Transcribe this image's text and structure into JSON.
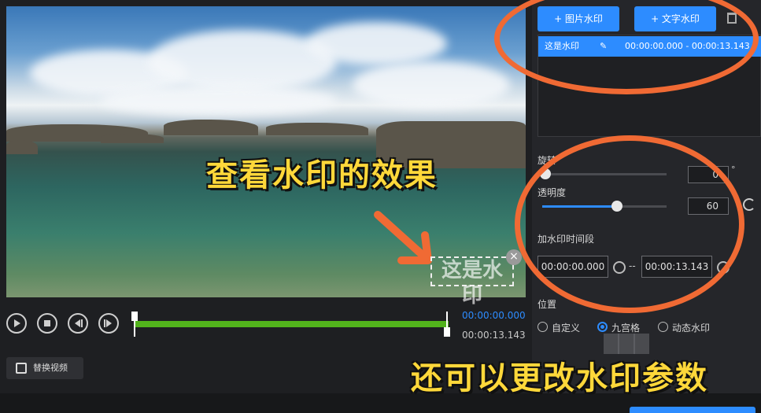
{
  "preview": {
    "overlay_text": "查看水印的效果",
    "watermark_text": "这是水印",
    "close_glyph": "×"
  },
  "timeline": {
    "current_time": "00:00:00.000",
    "end_time": "00:00:13.143",
    "controls": [
      "play",
      "stop",
      "prev-frame",
      "next-frame"
    ]
  },
  "replace_video": {
    "label": "替换视频"
  },
  "panel": {
    "image_watermark_btn": "+ 图片水印",
    "text_watermark_btn": "+ 文字水印",
    "list": [
      {
        "name": "这是水印",
        "range": "00:00:00.000 - 00:00:13.143"
      }
    ],
    "rotation": {
      "label": "旋转",
      "value": "0",
      "unit": "°",
      "level": 0
    },
    "opacity": {
      "label": "透明度",
      "value": "60",
      "level": 0.6
    },
    "time_segment": {
      "label": "加水印时间段",
      "start": "00:00:00.000",
      "separator": "--",
      "end": "00:00:13.143"
    },
    "position": {
      "label": "位置",
      "options": [
        "自定义",
        "九宫格",
        "动态水印"
      ],
      "selected": "九宫格"
    }
  },
  "caption": "还可以更改水印参数",
  "colors": {
    "accent": "#2d8cff",
    "annotation": "#f06a34",
    "caption": "#ffd83a",
    "progress": "#52b31c"
  }
}
